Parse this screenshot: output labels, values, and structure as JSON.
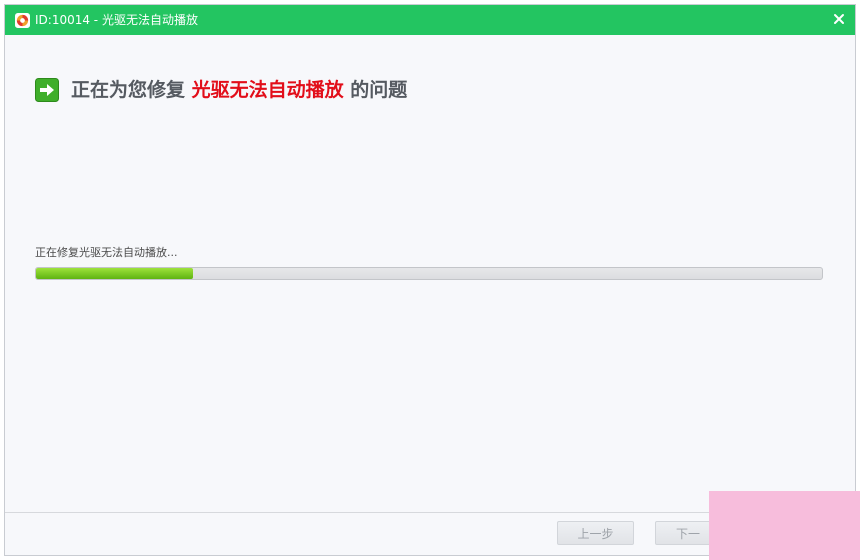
{
  "window": {
    "title": "ID:10014 - 光驱无法自动播放",
    "app_icon": "lifebuoy-icon",
    "close_icon": "close-icon",
    "accent_color": "#23c561"
  },
  "heading": {
    "prefix": "正在为您修复",
    "highlight": "光驱无法自动播放",
    "suffix": "的问题",
    "icon": "arrow-right-icon",
    "highlight_color": "#e20e1a"
  },
  "progress": {
    "status_text": "正在修复光驱无法自动播放...",
    "percent": 20
  },
  "footer": {
    "prev_label": "上一步",
    "next_label": "下一"
  }
}
